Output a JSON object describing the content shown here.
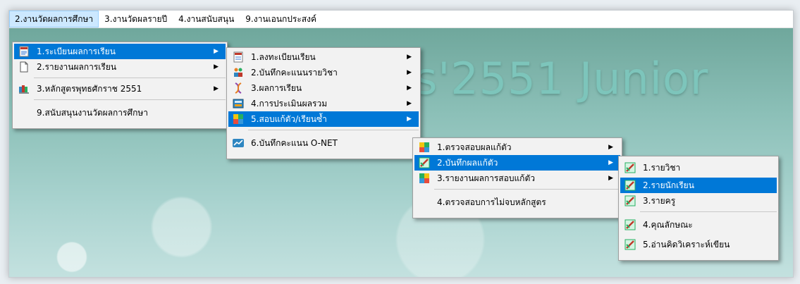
{
  "menubar": {
    "items": [
      {
        "label": "2.งานวัดผลการศึกษา"
      },
      {
        "label": "3.งานวัดผลรายปี"
      },
      {
        "label": "4.งานสนับสนุน"
      },
      {
        "label": "9.งานเอนกประสงค์"
      }
    ]
  },
  "splash_text": "s'2551 Junior",
  "menu1": {
    "items": [
      {
        "label": "1.ระเบียนผลการเรียน"
      },
      {
        "label": "2.รายงานผลการเรียน"
      },
      {
        "label": "3.หลักสูตรพุทธศักราช 2551"
      },
      {
        "label": "9.สนับสนุนงานวัดผลการศึกษา"
      }
    ]
  },
  "menu2": {
    "items": [
      {
        "label": "1.ลงทะเบียนเรียน"
      },
      {
        "label": "2.บันทึกคะแนนรายวิชา"
      },
      {
        "label": "3.ผลการเรียน"
      },
      {
        "label": "4.การประเมินผลรวม"
      },
      {
        "label": "5.สอบแก้ตัว/เรียนซ้ำ"
      },
      {
        "label": "6.บันทึกคะแนน O-NET"
      }
    ]
  },
  "menu3": {
    "items": [
      {
        "label": "1.ตรวจสอบผลแก้ตัว"
      },
      {
        "label": "2.บันทึกผลแก้ตัว"
      },
      {
        "label": "3.รายงานผลการสอบแก้ตัว"
      },
      {
        "label": "4.ตรวจสอบการไม่จบหลักสูตร"
      }
    ]
  },
  "menu4": {
    "items": [
      {
        "label": "1.รายวิชา"
      },
      {
        "label": "2.รายนักเรียน"
      },
      {
        "label": "3.รายครู"
      },
      {
        "label": "4.คุณลักษณะ"
      },
      {
        "label": "5.อ่านคิดวิเคราะห์เขียน"
      }
    ]
  },
  "colors": {
    "selection": "#0078d7",
    "menu_bg": "#f2f2f2",
    "menubar_active": "#cce8ff"
  }
}
